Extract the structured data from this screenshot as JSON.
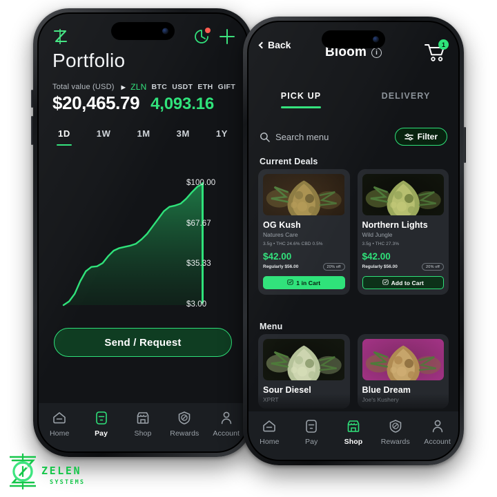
{
  "brand": {
    "logo_name": "ZELEN",
    "logo_sub": "SYSTEMS",
    "accent": "#2fe27a",
    "accent_bright": "#3ee57f"
  },
  "phone_left": {
    "app_name": "Portfolio app",
    "header": {
      "logo_icon": "zelen-z-icon",
      "notification_icon": "notification-bell-icon",
      "add_icon": "plus-icon"
    },
    "page_title": "Portfolio",
    "total_value_label": "Total value (USD)",
    "tickers": [
      {
        "symbol": "ZLN",
        "selected": true
      },
      {
        "symbol": "BTC",
        "selected": false
      },
      {
        "symbol": "USDT",
        "selected": false
      },
      {
        "symbol": "ETH",
        "selected": false
      },
      {
        "symbol": "GIFT",
        "selected": false
      }
    ],
    "value_usd": "$20,465.79",
    "value_zln": "4,093.16",
    "ranges": [
      {
        "label": "1D",
        "active": true
      },
      {
        "label": "1W",
        "active": false
      },
      {
        "label": "1M",
        "active": false
      },
      {
        "label": "3M",
        "active": false
      },
      {
        "label": "1Y",
        "active": false
      }
    ],
    "primary_button": "Send / Request",
    "tabs": [
      {
        "label": "Home",
        "icon": "home-icon",
        "active": false
      },
      {
        "label": "Pay",
        "icon": "pay-card-icon",
        "active": true
      },
      {
        "label": "Shop",
        "icon": "shop-storefront-icon",
        "active": false
      },
      {
        "label": "Rewards",
        "icon": "rewards-shield-icon",
        "active": false
      },
      {
        "label": "Account",
        "icon": "account-person-icon",
        "active": false
      }
    ]
  },
  "chart_data": {
    "type": "area",
    "title": "Portfolio value",
    "xlabel": "",
    "ylabel": "USD",
    "ylim": [
      3.0,
      100.0
    ],
    "grid": false,
    "legend": "none",
    "tick_labels": [
      "$100.00",
      "$67.67",
      "$35.33",
      "$3.00"
    ],
    "tick_values": [
      100.0,
      67.67,
      35.33,
      3.0
    ],
    "line_color": "#2fe27a",
    "fill_color": "#16432a",
    "cursor_label": "$100.00",
    "x": [
      0,
      4,
      8,
      12,
      16,
      20,
      24,
      28,
      32,
      36,
      40,
      44,
      48,
      52,
      56,
      60,
      64,
      68,
      72,
      76,
      80,
      84,
      88,
      92,
      96,
      100
    ],
    "values": [
      3.0,
      6.0,
      12.0,
      22.0,
      30.0,
      33.5,
      34.0,
      36.5,
      42.0,
      46.5,
      48.5,
      49.5,
      50.5,
      52.0,
      55.5,
      60.0,
      66.0,
      72.0,
      78.0,
      81.5,
      82.5,
      84.0,
      88.0,
      93.0,
      97.5,
      100.0
    ]
  },
  "phone_right": {
    "app_name": "Bloom shop",
    "header": {
      "back_label": "Back",
      "back_icon": "chevron-left-icon",
      "title": "Bloom",
      "info_icon": "info-circle-icon",
      "info_glyph": "i",
      "cart_icon": "shopping-cart-icon",
      "cart_count": "1"
    },
    "segments": [
      {
        "label": "PICK UP",
        "active": true
      },
      {
        "label": "DELIVERY",
        "active": false
      }
    ],
    "search": {
      "icon": "search-icon",
      "placeholder": "Search menu",
      "value": ""
    },
    "filter": {
      "icon": "filter-sliders-icon",
      "label": "Filter"
    },
    "sections": [
      {
        "title": "Current Deals",
        "products": [
          {
            "name": "OG Kush",
            "vendor": "Natures Care",
            "spec": "3.5g • THC 24.6% CBD 0.5%",
            "price": "$42.00",
            "regular": "Regularly $56.00",
            "badge": "20% off",
            "cta": "1 in Cart",
            "cta_icon": "cart-check-icon",
            "cta_style": "filled",
            "image": "og-kush-bud-photo"
          },
          {
            "name": "Northern Lights",
            "vendor": "Wild Jungle",
            "spec": "3.5g • THC 27.3%",
            "price": "$42.00",
            "regular": "Regularly $56.00",
            "badge": "20% off",
            "cta": "Add to Cart",
            "cta_icon": "cart-add-icon",
            "cta_style": "outline",
            "image": "northern-lights-bud-photo"
          }
        ]
      },
      {
        "title": "Menu",
        "products": [
          {
            "name": "Sour Diesel",
            "vendor": "XPRT",
            "image": "sour-diesel-bud-photo"
          },
          {
            "name": "Blue Dream",
            "vendor": "Joe's Kushery",
            "image": "blue-dream-bud-photo"
          }
        ]
      }
    ],
    "tabs": [
      {
        "label": "Home",
        "icon": "home-icon",
        "active": false
      },
      {
        "label": "Pay",
        "icon": "pay-card-icon",
        "active": false
      },
      {
        "label": "Shop",
        "icon": "shop-storefront-icon",
        "active": true
      },
      {
        "label": "Rewards",
        "icon": "rewards-shield-icon",
        "active": false
      },
      {
        "label": "Account",
        "icon": "account-person-icon",
        "active": false
      }
    ]
  }
}
